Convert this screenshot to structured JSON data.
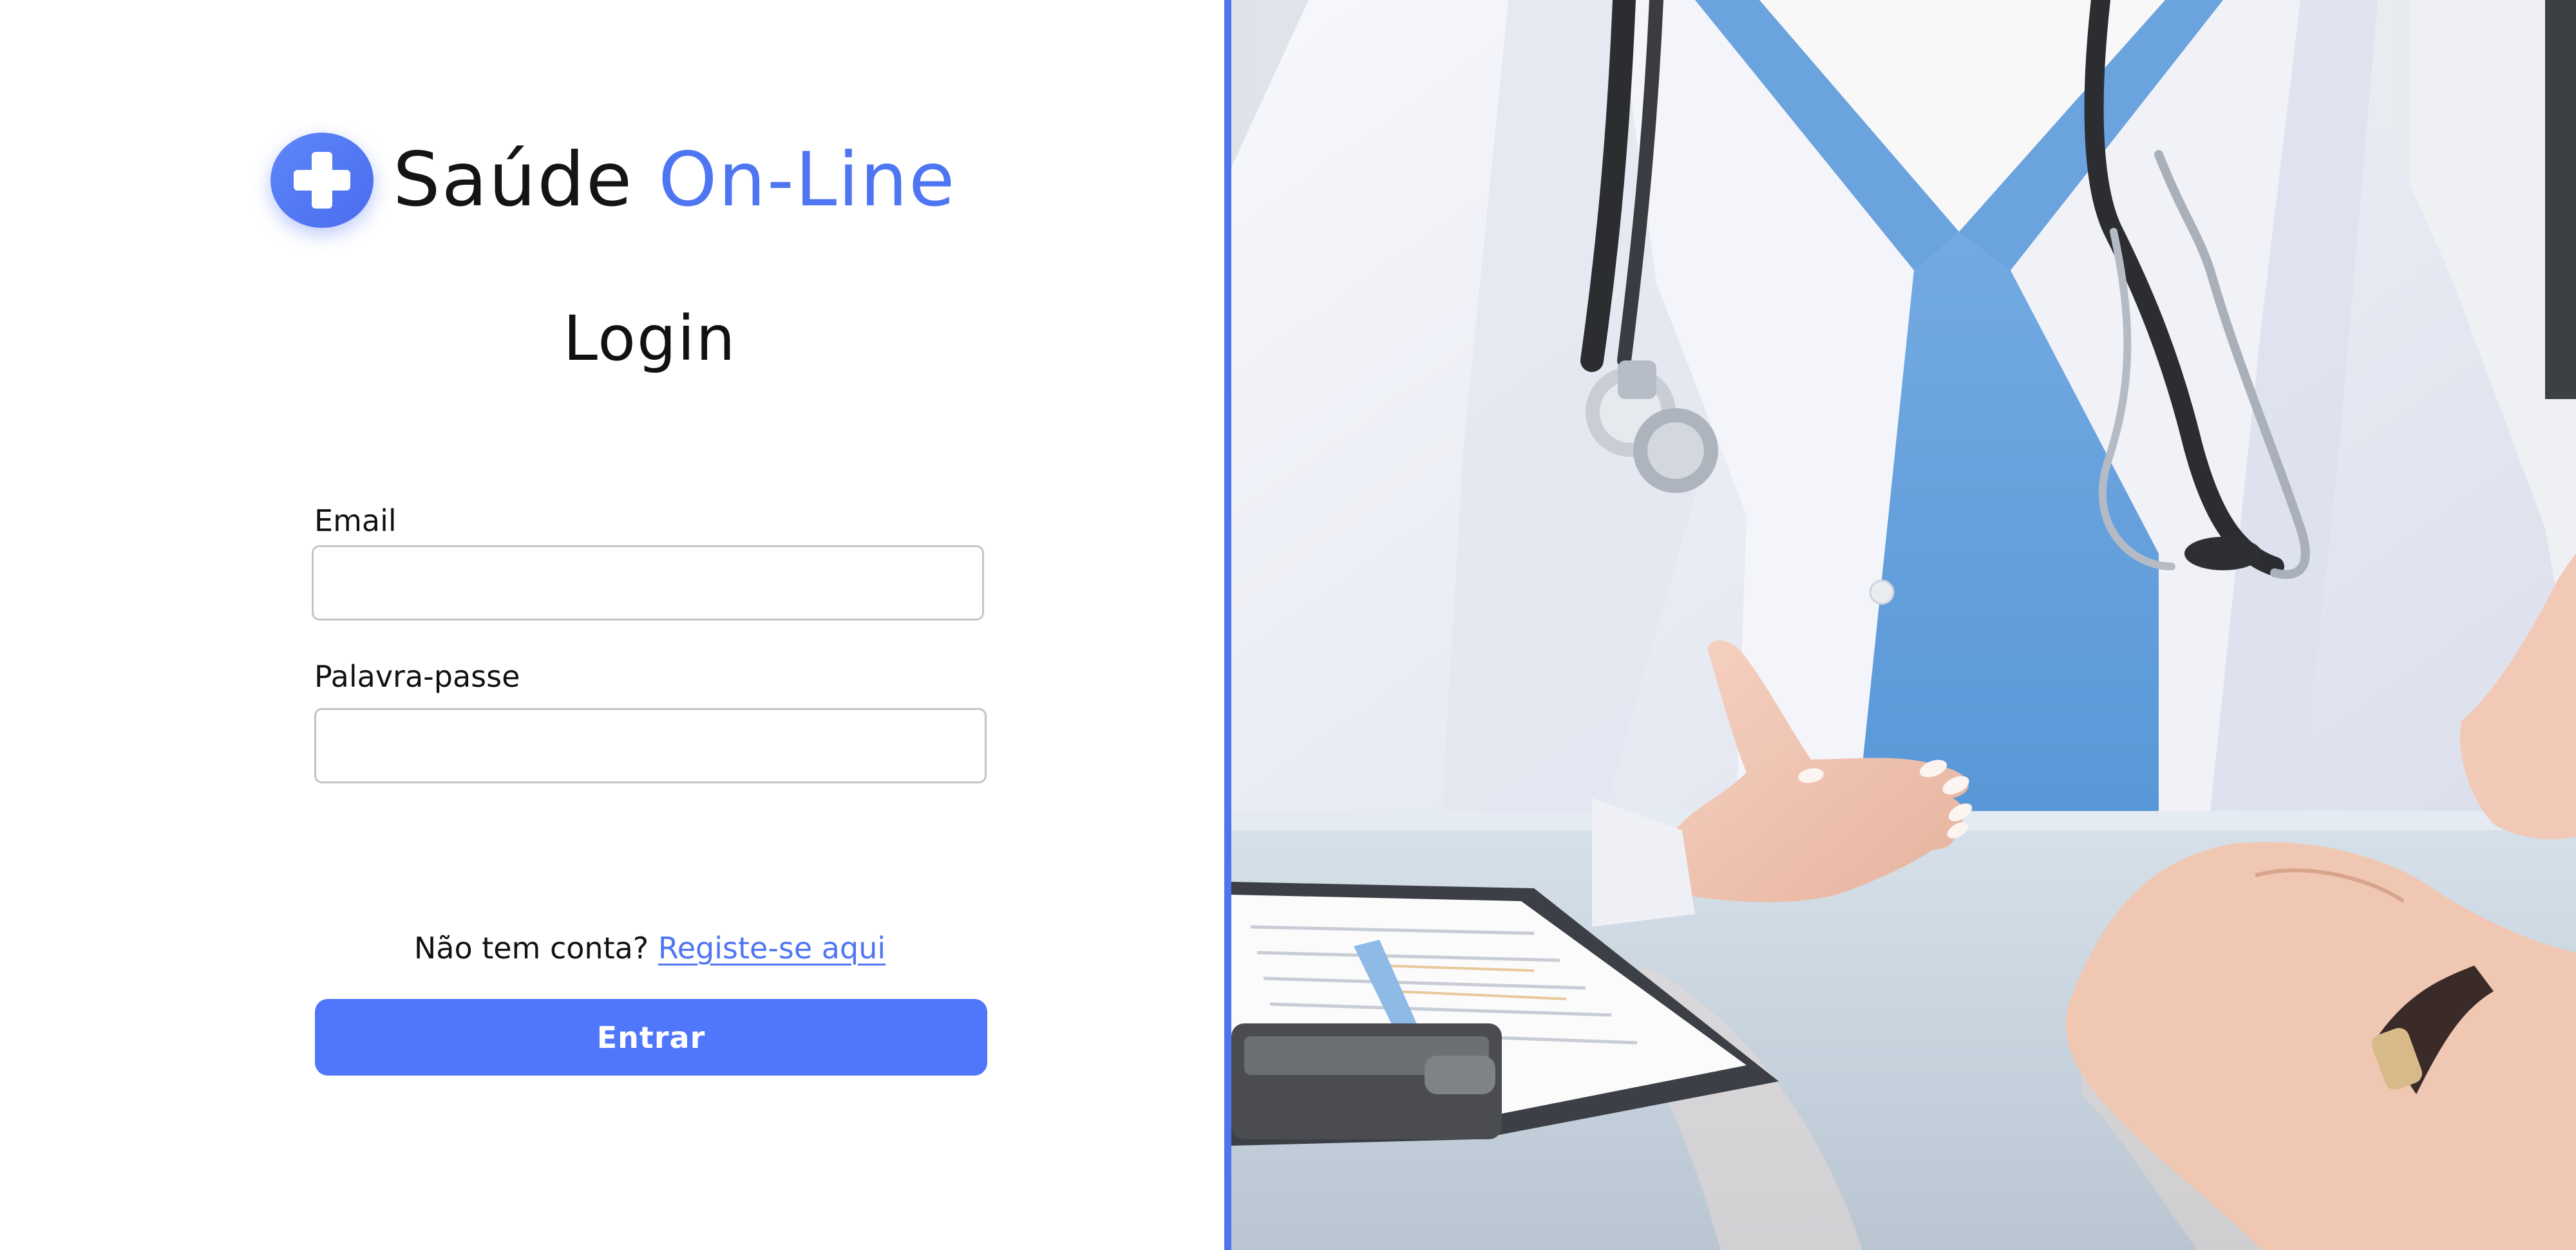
{
  "brand": {
    "name": "Saúde",
    "accent": "On-Line",
    "logo_icon": "medical-cross-icon"
  },
  "login": {
    "title": "Login",
    "email_label": "Email",
    "email_value": "",
    "password_label": "Palavra-passe",
    "password_value": "",
    "register_prompt": "Não tem conta?",
    "register_link": "Registe-se aqui",
    "submit_label": "Entrar"
  },
  "photo": {
    "subject": "doctor-consultation-photo"
  },
  "colors": {
    "accent": "#4f76f2",
    "button": "#5077fb",
    "divider": "#4f74f0",
    "text": "#111111",
    "input_border": "#c4c4c4"
  }
}
